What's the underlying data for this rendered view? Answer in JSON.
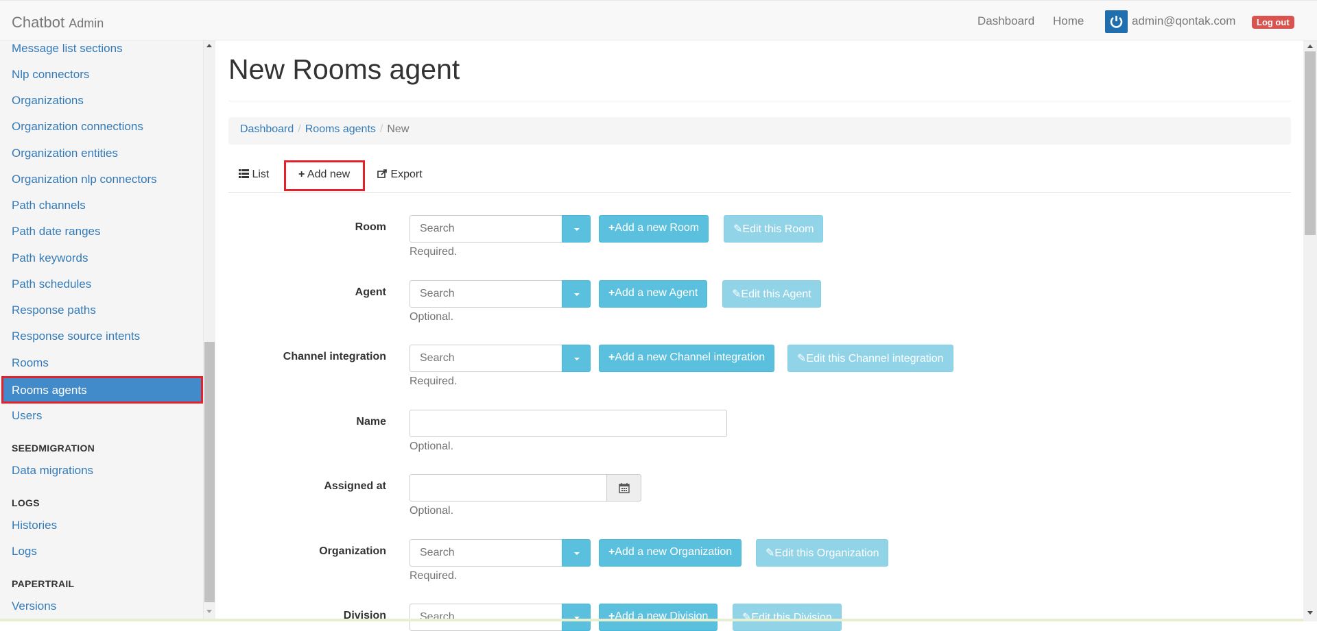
{
  "navbar": {
    "brand": "Chatbot",
    "brand_suffix": "Admin",
    "links": [
      "Dashboard",
      "Home"
    ],
    "user_email": "admin@qontak.com",
    "logout_label": "Log out"
  },
  "sidebar": {
    "items_top": [
      "Message list sections",
      "Nlp connectors",
      "Organizations",
      "Organization connections",
      "Organization entities",
      "Organization nlp connectors",
      "Path channels",
      "Path date ranges",
      "Path keywords",
      "Path schedules",
      "Response paths",
      "Response source intents",
      "Rooms"
    ],
    "active_item": "Rooms agents",
    "item_after_active": "Users",
    "sections": [
      {
        "title": "SEEDMIGRATION",
        "items": [
          "Data migrations"
        ]
      },
      {
        "title": "LOGS",
        "items": [
          "Histories",
          "Logs"
        ]
      },
      {
        "title": "PAPERTRAIL",
        "items": [
          "Versions"
        ]
      }
    ]
  },
  "page": {
    "title": "New Rooms agent",
    "breadcrumb": [
      "Dashboard",
      "Rooms agents",
      "New"
    ],
    "tabs": {
      "list": "List",
      "add_new": "Add new",
      "export": "Export"
    }
  },
  "form": {
    "search_placeholder": "Search",
    "fields": [
      {
        "label": "Room",
        "add": "Add a new Room",
        "edit": "Edit this Room",
        "help": "Required."
      },
      {
        "label": "Agent",
        "add": "Add a new Agent",
        "edit": "Edit this Agent",
        "help": "Optional."
      },
      {
        "label": "Channel integration",
        "add": "Add a new Channel integration",
        "edit": "Edit this Channel integration",
        "help": "Required."
      },
      {
        "label": "Name",
        "help": "Optional."
      },
      {
        "label": "Assigned at",
        "help": "Optional."
      },
      {
        "label": "Organization",
        "add": "Add a new Organization",
        "edit": "Edit this Organization",
        "help": "Required."
      },
      {
        "label": "Division",
        "add": "Add a new Division",
        "edit": "Edit this Division"
      }
    ]
  }
}
